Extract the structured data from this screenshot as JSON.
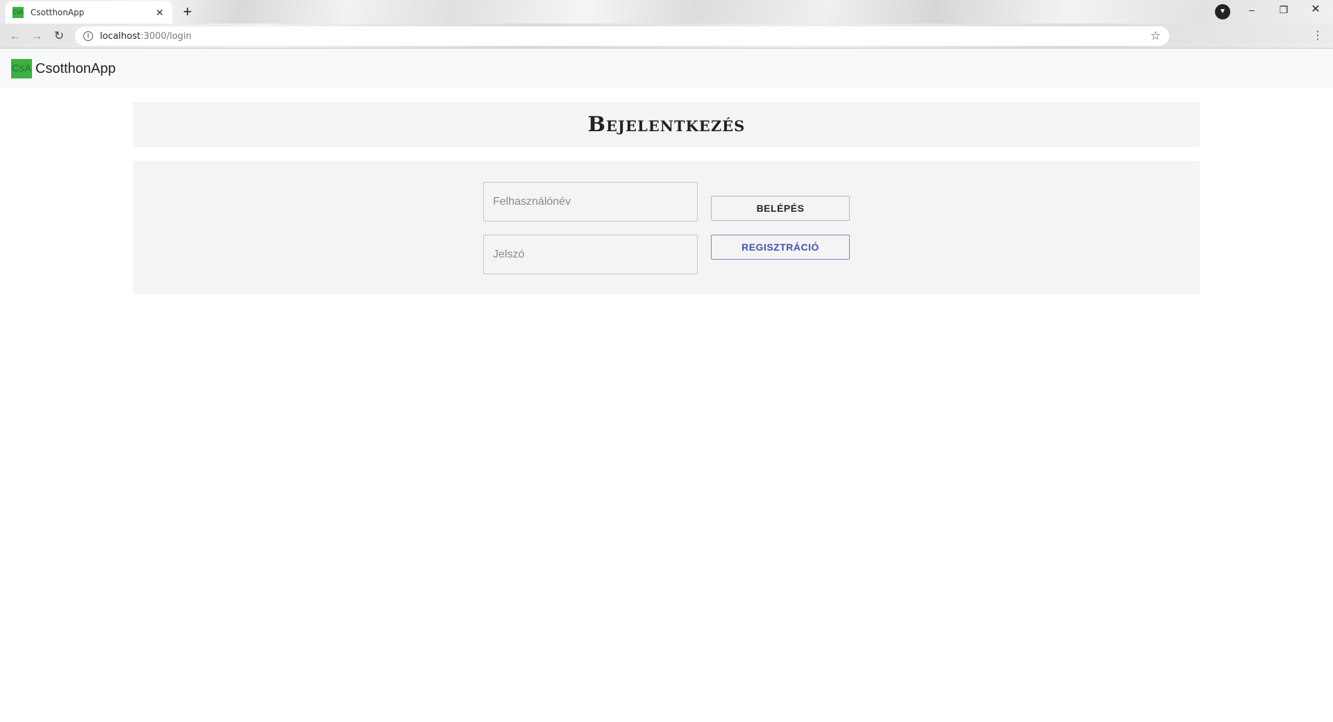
{
  "browser": {
    "tab_title": "CsotthonApp",
    "tab_favicon_text": "CsA",
    "tab_close": "✕",
    "new_tab": "+",
    "url_host": "localhost",
    "url_path": ":3000/login",
    "window_controls": {
      "minimize": "–",
      "maximize": "❐",
      "close": "✕"
    }
  },
  "navbar": {
    "logo_text": "CsA",
    "brand_name": "CsotthonApp",
    "logo_color": "#3cb043"
  },
  "page": {
    "title": "Bejelentkezés"
  },
  "login_form": {
    "username_placeholder": "Felhasználónév",
    "password_placeholder": "Jelszó",
    "login_button": "BELÉPÉS",
    "register_button": "REGISZTRÁCIÓ",
    "register_color": "#3f51b5"
  },
  "icons": {
    "back": "arrow-left-icon",
    "forward": "arrow-right-icon",
    "reload": "reload-icon",
    "info": "info-icon",
    "star": "star-icon",
    "menu": "more-vertical-icon",
    "profile": "profile-icon"
  }
}
